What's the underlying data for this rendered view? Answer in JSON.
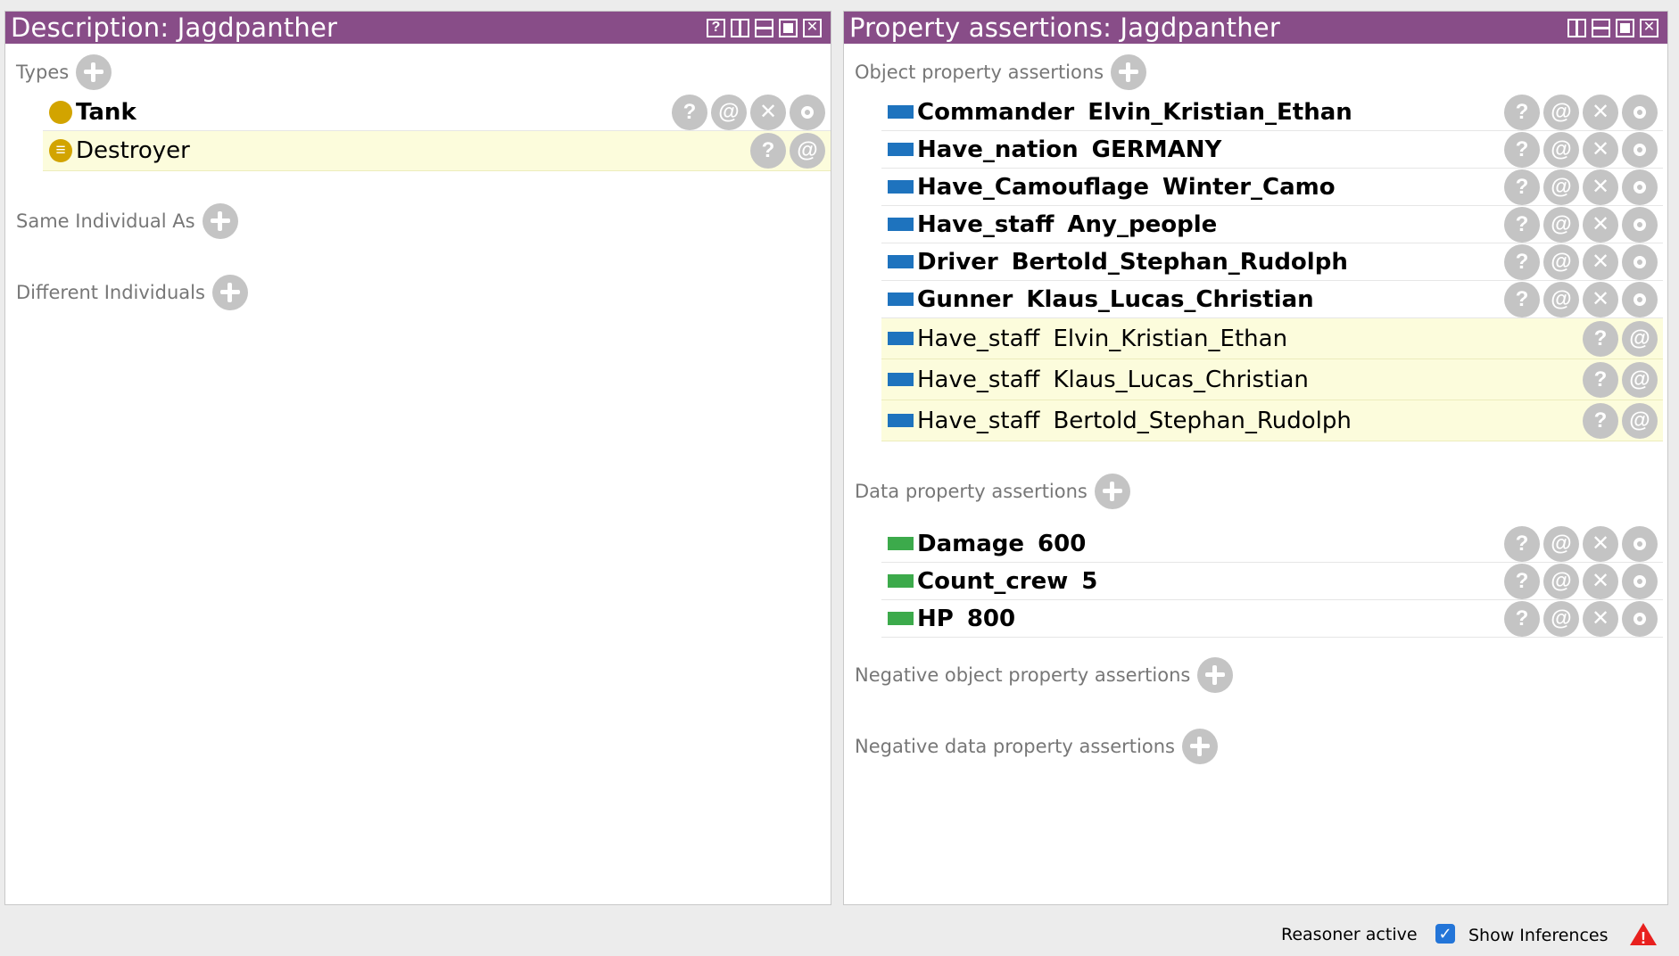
{
  "left_view": {
    "title": "Description: Jagdpanther",
    "sections": {
      "types": {
        "label": "Types",
        "items": [
          {
            "label": "Tank",
            "bold": true,
            "inferred": false
          },
          {
            "label": "Destroyer",
            "bold": false,
            "inferred": true
          }
        ]
      },
      "same_individual": {
        "label": "Same Individual As"
      },
      "different_individuals": {
        "label": "Different Individuals"
      }
    }
  },
  "right_view": {
    "title": "Property assertions: Jagdpanther",
    "sections": {
      "object_props": {
        "label": "Object property assertions",
        "items": [
          {
            "property": "Commander",
            "value": "Elvin_Kristian_Ethan",
            "bold": true,
            "inferred": false
          },
          {
            "property": "Have_nation",
            "value": "GERMANY",
            "bold": true,
            "inferred": false
          },
          {
            "property": "Have_Camouflage",
            "value": "Winter_Camo",
            "bold": true,
            "inferred": false
          },
          {
            "property": "Have_staff",
            "value": "Any_people",
            "bold": true,
            "inferred": false
          },
          {
            "property": "Driver",
            "value": "Bertold_Stephan_Rudolph",
            "bold": true,
            "inferred": false
          },
          {
            "property": "Gunner",
            "value": "Klaus_Lucas_Christian",
            "bold": true,
            "inferred": false
          },
          {
            "property": "Have_staff",
            "value": "Elvin_Kristian_Ethan",
            "bold": false,
            "inferred": true
          },
          {
            "property": "Have_staff",
            "value": "Klaus_Lucas_Christian",
            "bold": false,
            "inferred": true
          },
          {
            "property": "Have_staff",
            "value": "Bertold_Stephan_Rudolph",
            "bold": false,
            "inferred": true
          }
        ]
      },
      "data_props": {
        "label": "Data property assertions",
        "items": [
          {
            "property": "Damage",
            "value": "600",
            "bold": true,
            "inferred": false
          },
          {
            "property": "Count_crew",
            "value": "5",
            "bold": true,
            "inferred": false
          },
          {
            "property": "HP",
            "value": "800",
            "bold": true,
            "inferred": false
          }
        ]
      },
      "negative_object_props": {
        "label": "Negative object property assertions"
      },
      "negative_data_props": {
        "label": "Negative data property assertions"
      }
    }
  },
  "button_glyphs": {
    "explain": "?",
    "annotate": "@",
    "delete": "✕",
    "edit": "ring-icon",
    "close": "✕"
  },
  "status_bar": {
    "reasoner_status": "Reasoner active",
    "show_inferences_label": "Show Inferences",
    "show_inferences_checked": true,
    "check_glyph": "✓",
    "warning_glyph": "!"
  },
  "colors": {
    "title_bar": "#884d88",
    "inferred_row": "#fcfcdc",
    "object_property": "#1e73be",
    "data_property": "#3caa4b",
    "class_icon": "#d2a400",
    "warning": "#e8201e",
    "checkbox": "#2375d8"
  }
}
